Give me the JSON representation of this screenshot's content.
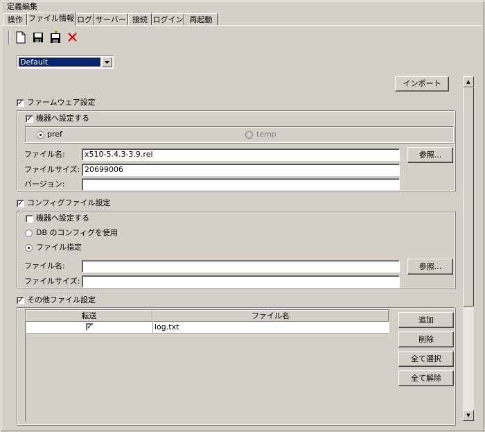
{
  "window": {
    "title": "定義編集"
  },
  "tabs": [
    {
      "label": "操作"
    },
    {
      "label": "ファイル情報"
    },
    {
      "label": "ログ"
    },
    {
      "label": "サーバー"
    },
    {
      "label": "接続"
    },
    {
      "label": "ログイン"
    },
    {
      "label": "再起動"
    }
  ],
  "active_tab": "ファイル情報",
  "toolbar": {
    "icons": [
      "new-file-icon",
      "save-icon",
      "save-as-icon",
      "delete-icon"
    ]
  },
  "profile": {
    "selected": "Default"
  },
  "import_button": "インポート",
  "firmware": {
    "enabled_label": "ファームウェア設定",
    "apply_label": "機器へ設定する",
    "pref_label": "pref",
    "temp_label": "temp",
    "filename_label": "ファイル名:",
    "filename_value": "x510-5.4.3-3.9.rel",
    "filesize_label": "ファイルサイズ:",
    "filesize_value": "20699006",
    "version_label": "バージョン:",
    "version_value": "",
    "browse_button": "参照..."
  },
  "config": {
    "enabled_label": "コンフィグファイル設定",
    "apply_label": "機器へ設定する",
    "use_db_label": "DB のコンフィグを使用",
    "file_specify_label": "ファイル指定",
    "filename_label": "ファイル名:",
    "filename_value": "",
    "filesize_label": "ファイルサイズ:",
    "filesize_value": "",
    "browse_button": "参照..."
  },
  "other_files": {
    "enabled_label": "その他ファイル設定",
    "columns": [
      "転送",
      "ファイル名"
    ],
    "rows": [
      {
        "transfer": true,
        "filename": "log.txt"
      }
    ],
    "add_button": "追加",
    "remove_button": "削除",
    "select_all_button": "全て選択",
    "deselect_all_button": "全て解除"
  },
  "colors": {
    "face": "#d4d0c8",
    "selection": "#0a246a",
    "delete_icon": "#cc0000"
  }
}
